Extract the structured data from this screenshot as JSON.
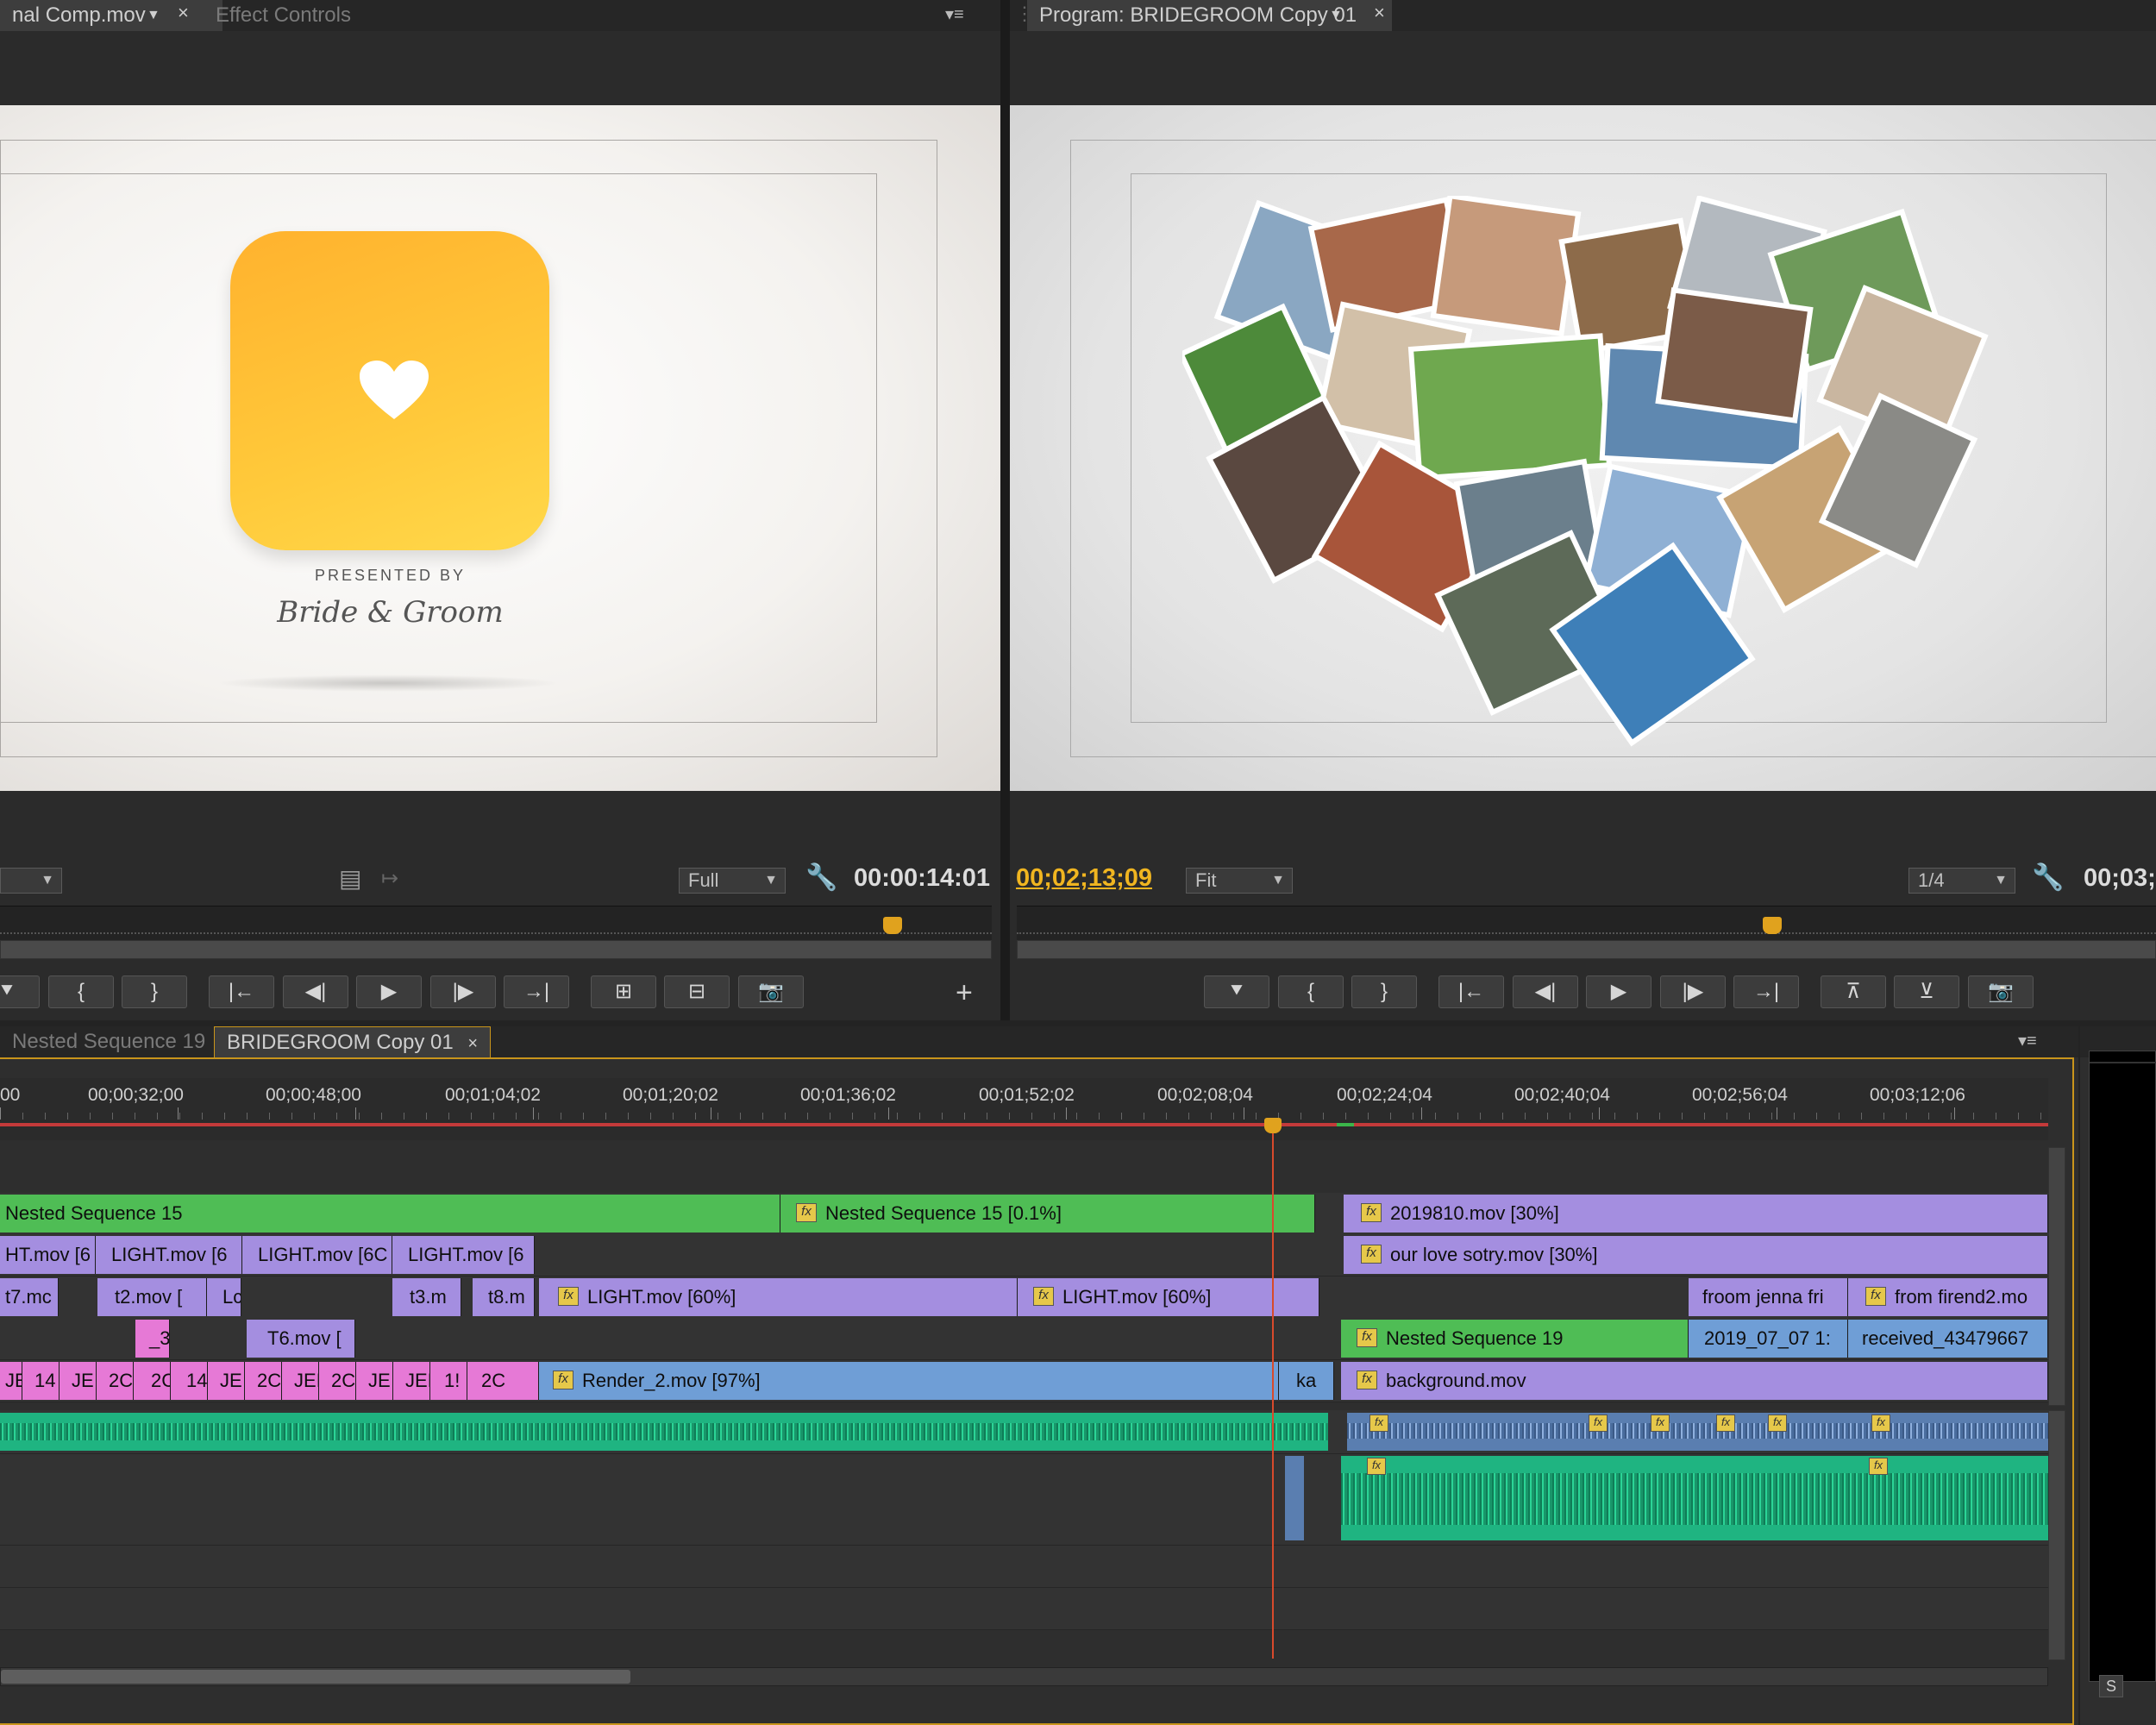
{
  "source_panel": {
    "tab_clip": "nal Comp.mov",
    "tab_effect_controls": "Effect Controls",
    "timecode": "00:00:14:01",
    "quality": "Full",
    "preview": {
      "presented_by": "PRESENTED BY",
      "names": "Bride & Groom"
    }
  },
  "program_panel": {
    "tab_title": "Program: BRIDEGROOM Copy 01",
    "timecode_current": "00;02;13;09",
    "fit": "Fit",
    "resolution": "1/4",
    "timecode_duration": "00;03;"
  },
  "timeline": {
    "tabs": [
      "Nested Sequence 19",
      "BRIDEGROOM Copy 01"
    ],
    "ruler_labels": [
      "00",
      "00;00;32;00",
      "00;00;48;00",
      "00;01;04;02",
      "00;01;20;02",
      "00;01;36;02",
      "00;01;52;02",
      "00;02;08;04",
      "00;02;24;04",
      "00;02;40;04",
      "00;02;56;04",
      "00;03;12;06"
    ],
    "clips": {
      "v5_a": "Nested Sequence 15",
      "v5_b": "Nested Sequence 15 [0.1%]",
      "v5_c": "2019810.mov [30%]",
      "v4_a": "HT.mov [6",
      "v4_b": "LIGHT.mov [6",
      "v4_c": "LIGHT.mov [6C",
      "v4_d": "LIGHT.mov [6",
      "v4_e": "our love sotry.mov [30%]",
      "v3_a": "t7.mc",
      "v3_b": "t2.mov [",
      "v3_c": "Lc",
      "v3_d": "t3.m",
      "v3_e": "t8.m",
      "v3_f": "LIGHT.mov [60%]",
      "v3_g": "LIGHT.mov [60%]",
      "v3_h": "froom jenna fri",
      "v3_i": "from firend2.mo",
      "v2_a": "_3",
      "v2_b": "T6.mov [",
      "v2_c": "Nested Sequence 19",
      "v2_d": "2019_07_07 1:",
      "v2_e": "received_43479667",
      "v1_small": [
        "JE",
        "14",
        "JE",
        "2C",
        "2C",
        "14",
        "JE",
        "2C",
        "JEI",
        "2C",
        "JE",
        "JEI",
        "1!",
        "2C"
      ],
      "v1_a": "Render_2.mov [97%]",
      "v1_b": "ka",
      "v1_c": "background.mov"
    },
    "fx_label": "fx",
    "s_button": "S"
  },
  "colors": {
    "playhead": "#e0a21e",
    "timecode_yellow": "#f0b520",
    "clip_green": "#4fbd55",
    "clip_purple": "#a48ee0",
    "clip_pink": "#e679d6",
    "clip_blue": "#6f9ed6",
    "audio_green": "#1fb481"
  }
}
